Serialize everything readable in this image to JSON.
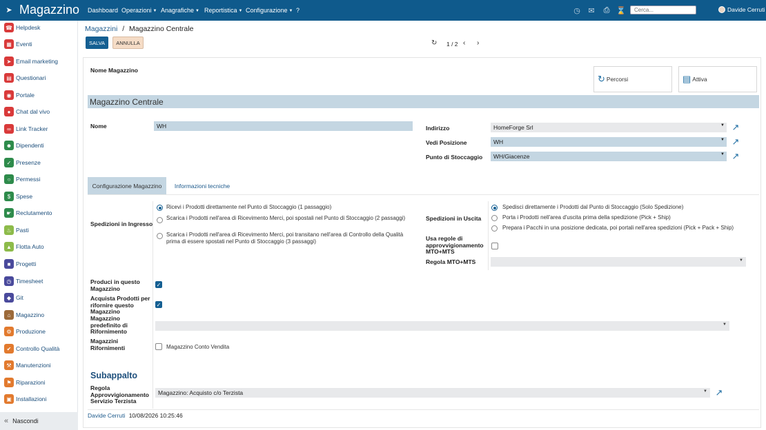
{
  "app": {
    "name": "Magazzino"
  },
  "topbar": {
    "menus": [
      {
        "label": "Dashboard",
        "dropdown": false
      },
      {
        "label": "Operazioni",
        "dropdown": true
      },
      {
        "label": "Anagrafiche",
        "dropdown": true
      },
      {
        "label": "Reportistica",
        "dropdown": true
      },
      {
        "label": "Configurazione",
        "dropdown": true
      },
      {
        "label": "?",
        "dropdown": false
      }
    ],
    "icons": [
      "clock-icon",
      "chat-icon",
      "printer-icon",
      "spinner-icon"
    ],
    "search_placeholder": "Cerca...",
    "user_name": "Davide Cerruti",
    "bg_color": "#0f5a8c"
  },
  "sidebar": {
    "items": [
      {
        "label": "Helpdesk",
        "icon": "headset-icon",
        "color": "#d93a3a"
      },
      {
        "label": "Eventi",
        "icon": "calendar-icon",
        "color": "#d93a3a"
      },
      {
        "label": "Email marketing",
        "icon": "paper-plane-icon",
        "color": "#d93a3a"
      },
      {
        "label": "Questionari",
        "icon": "clipboard-icon",
        "color": "#d93a3a"
      },
      {
        "label": "Portale",
        "icon": "globe-icon",
        "color": "#d93a3a"
      },
      {
        "label": "Chat dal vivo",
        "icon": "chat-bubble-icon",
        "color": "#d93a3a"
      },
      {
        "label": "Link Tracker",
        "icon": "link-icon",
        "color": "#d93a3a"
      },
      {
        "label": "Dipendenti",
        "icon": "users-icon",
        "color": "#2e8b4b"
      },
      {
        "label": "Presenze",
        "icon": "user-check-icon",
        "color": "#2e8b4b"
      },
      {
        "label": "Permessi",
        "icon": "calendar-check-icon",
        "color": "#2e8b4b"
      },
      {
        "label": "Spese",
        "icon": "dollar-icon",
        "color": "#2e8b4b"
      },
      {
        "label": "Reclutamento",
        "icon": "handshake-icon",
        "color": "#2e8b4b"
      },
      {
        "label": "Pasti",
        "icon": "cutlery-icon",
        "color": "#8dbb4a"
      },
      {
        "label": "Flotta Auto",
        "icon": "car-icon",
        "color": "#8dbb4a"
      },
      {
        "label": "Progetti",
        "icon": "puzzle-icon",
        "color": "#4a4a9c"
      },
      {
        "label": "Timesheet",
        "icon": "stopwatch-icon",
        "color": "#4a4a9c"
      },
      {
        "label": "Git",
        "icon": "git-icon",
        "color": "#4a4a9c"
      },
      {
        "label": "Magazzino",
        "icon": "warehouse-icon",
        "color": "#9c6a3a"
      },
      {
        "label": "Produzione",
        "icon": "industry-icon",
        "color": "#e27a2e"
      },
      {
        "label": "Controllo Qualità",
        "icon": "quality-icon",
        "color": "#e27a2e"
      },
      {
        "label": "Manutenzioni",
        "icon": "wrench-icon",
        "color": "#e27a2e"
      },
      {
        "label": "Riparazioni",
        "icon": "tools-icon",
        "color": "#e27a2e"
      },
      {
        "label": "Installazioni",
        "icon": "screen-icon",
        "color": "#e27a2e"
      }
    ],
    "hide_label": "Nascondi"
  },
  "breadcrumb": {
    "parent": "Magazzini",
    "separator": "/",
    "current": "Magazzino Centrale"
  },
  "actions": {
    "save": "SALVA",
    "discard": "ANNULLA"
  },
  "pager": {
    "text": "1 / 2"
  },
  "form": {
    "name_label": "Nome Magazzino",
    "name_value": "Magazzino Centrale",
    "smart_buttons": [
      {
        "label": "Percorsi",
        "icon": "refresh-icon"
      },
      {
        "label": "Attiva",
        "icon": "archive-icon"
      }
    ],
    "short_name_label": "Nome",
    "short_name_value": "WH",
    "address_label": "Indirizzo",
    "address_value": "HomeForge Srl",
    "location_label": "Vedi Posizione",
    "location_value": "WH",
    "stock_label": "Punto di Stoccaggio",
    "stock_value": "WH/Giacenze"
  },
  "tabs": [
    {
      "label": "Configurazione Magazzino",
      "active": true
    },
    {
      "label": "Informazioni tecniche",
      "active": false
    }
  ],
  "config": {
    "reception_label": "Spedizioni in Ingresso",
    "reception_options": [
      {
        "label": "Ricevi i Prodotti direttamente nel Punto di Stoccaggio (1 passaggio)",
        "selected": true
      },
      {
        "label": "Scarica i Prodotti nell'area di Ricevimento Merci, poi spostali nel Punto di Stoccaggio (2 passaggi)",
        "selected": false
      },
      {
        "label": "Scarica i Prodotti nell'area di Ricevimento Merci, poi transitano nell'area di Controllo della Qualità prima di essere spostati nel Punto di Stoccaggio (3 passaggi)",
        "selected": false
      }
    ],
    "delivery_label": "Spedizioni in Uscita",
    "delivery_options": [
      {
        "label": "Spedisci direttamente i Prodotti dal Punto di Stoccaggio (Solo Spedizione)",
        "selected": true
      },
      {
        "label": "Porta i Prodotti nell'area d'uscita prima della spedizione (Pick + Ship)",
        "selected": false
      },
      {
        "label": "Prepara i Pacchi in una posizione dedicata, poi portali nell'area spedizioni (Pick + Pack + Ship)",
        "selected": false
      }
    ],
    "mto_label": "Usa regole di approvvigionamento MTO+MTS",
    "mto_checked": false,
    "mto_rule_label": "Regola MTO+MTS",
    "mto_rule_value": "",
    "manufacture_label": "Produci in questo Magazzino",
    "manufacture_checked": true,
    "buy_label": "Acquista Prodotti per rifornire questo Magazzino",
    "buy_checked": true,
    "default_resupply_label": "Magazzino predefinito di Rifornimento",
    "default_resupply_value": "",
    "resupply_label": "Magazzini Rifornimenti",
    "resupply_option": "Magazzino Conto Vendita",
    "resupply_checked": false
  },
  "subcontract": {
    "title": "Subappalto",
    "rule_label": "Regola Approvvigionamento Servizio Terzista",
    "rule_value": "Magazzino: Acquisto c/o Terzista"
  },
  "footer": {
    "user": "Davide Cerruti",
    "date": "10/08/2026 10:25:46"
  }
}
